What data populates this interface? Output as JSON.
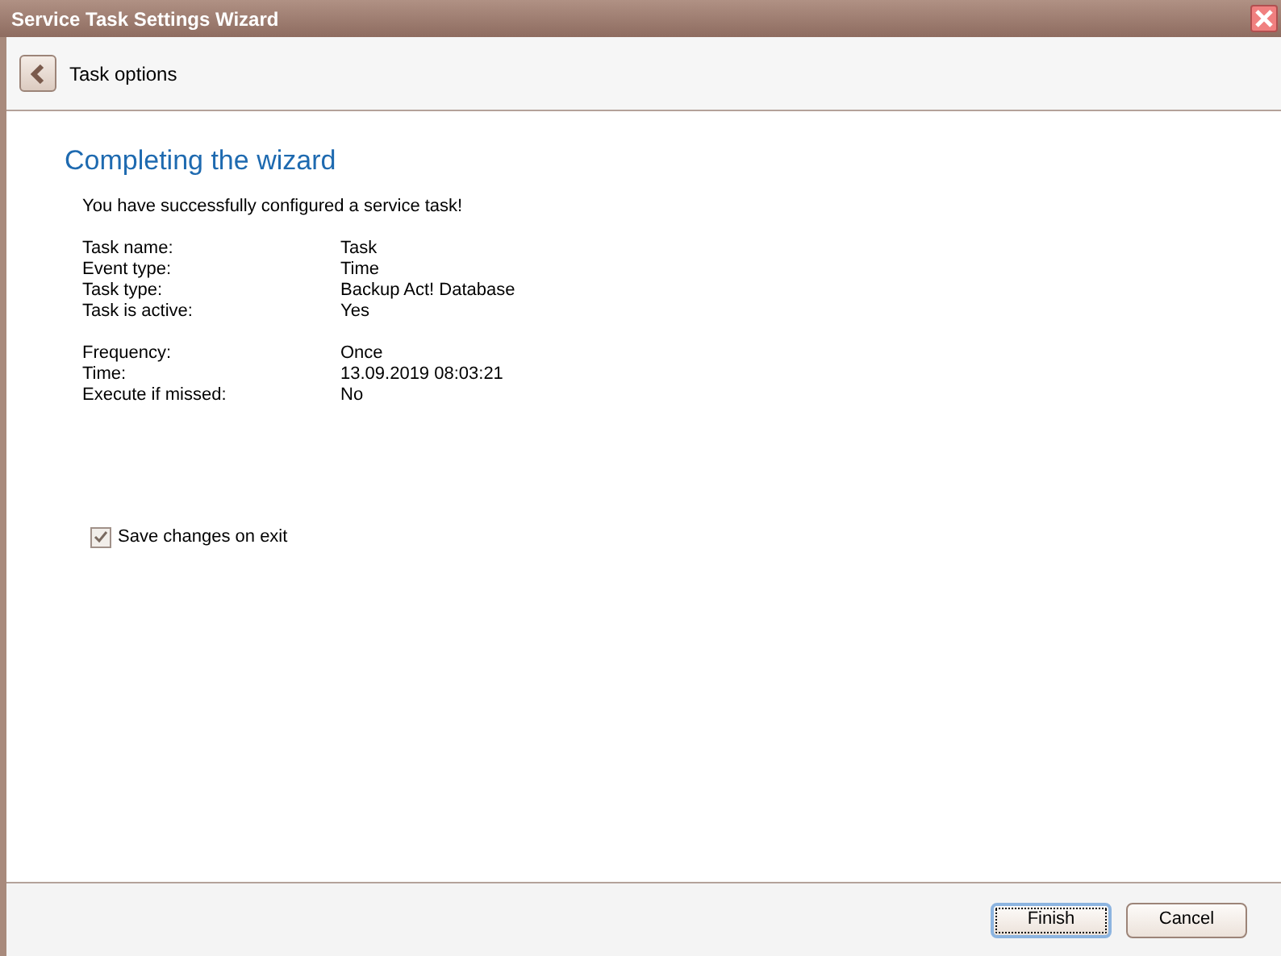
{
  "window": {
    "title": "Service Task Settings Wizard"
  },
  "header": {
    "back_label": "Task options"
  },
  "page": {
    "heading": "Completing the wizard",
    "message": "You have successfully configured a service task!",
    "groups": [
      {
        "rows": [
          {
            "label": "Task name:",
            "value": "Task"
          },
          {
            "label": "Event type:",
            "value": "Time"
          },
          {
            "label": "Task type:",
            "value": "Backup Act! Database"
          },
          {
            "label": "Task is active:",
            "value": "Yes"
          }
        ]
      },
      {
        "rows": [
          {
            "label": "Frequency:",
            "value": "Once"
          },
          {
            "label": "Time:",
            "value": "13.09.2019 08:03:21"
          },
          {
            "label": "Execute if missed:",
            "value": "No"
          }
        ]
      }
    ],
    "save_on_exit": {
      "label": "Save changes on exit",
      "checked": true
    }
  },
  "buttons": [
    {
      "label": "Finish",
      "focused": true
    },
    {
      "label": "Cancel",
      "focused": false
    }
  ]
}
